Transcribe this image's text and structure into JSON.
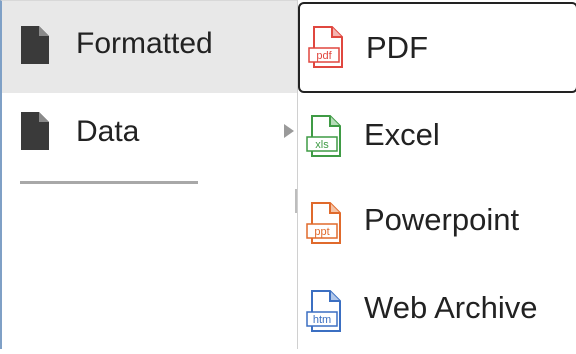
{
  "left_menu": {
    "items": [
      {
        "label": "Formatted",
        "icon": "document-icon",
        "selected": true
      },
      {
        "label": "Data",
        "icon": "document-icon",
        "has_submenu": true
      }
    ]
  },
  "submenu": {
    "items": [
      {
        "label": "PDF",
        "badge": "pdf",
        "icon": "pdf-file-icon",
        "color": "#e0473f",
        "focused": true
      },
      {
        "label": "Excel",
        "badge": "xls",
        "icon": "excel-file-icon",
        "color": "#3f9b45"
      },
      {
        "label": "Powerpoint",
        "badge": "ppt",
        "icon": "powerpoint-file-icon",
        "color": "#e06a2c"
      },
      {
        "label": "Web Archive",
        "badge": "htm",
        "icon": "web-archive-file-icon",
        "color": "#3b6fc2"
      }
    ]
  },
  "colors": {
    "selected_bg": "#e8e8e8",
    "focus_border": "#222222",
    "doc_icon": "#3a3a3a"
  }
}
